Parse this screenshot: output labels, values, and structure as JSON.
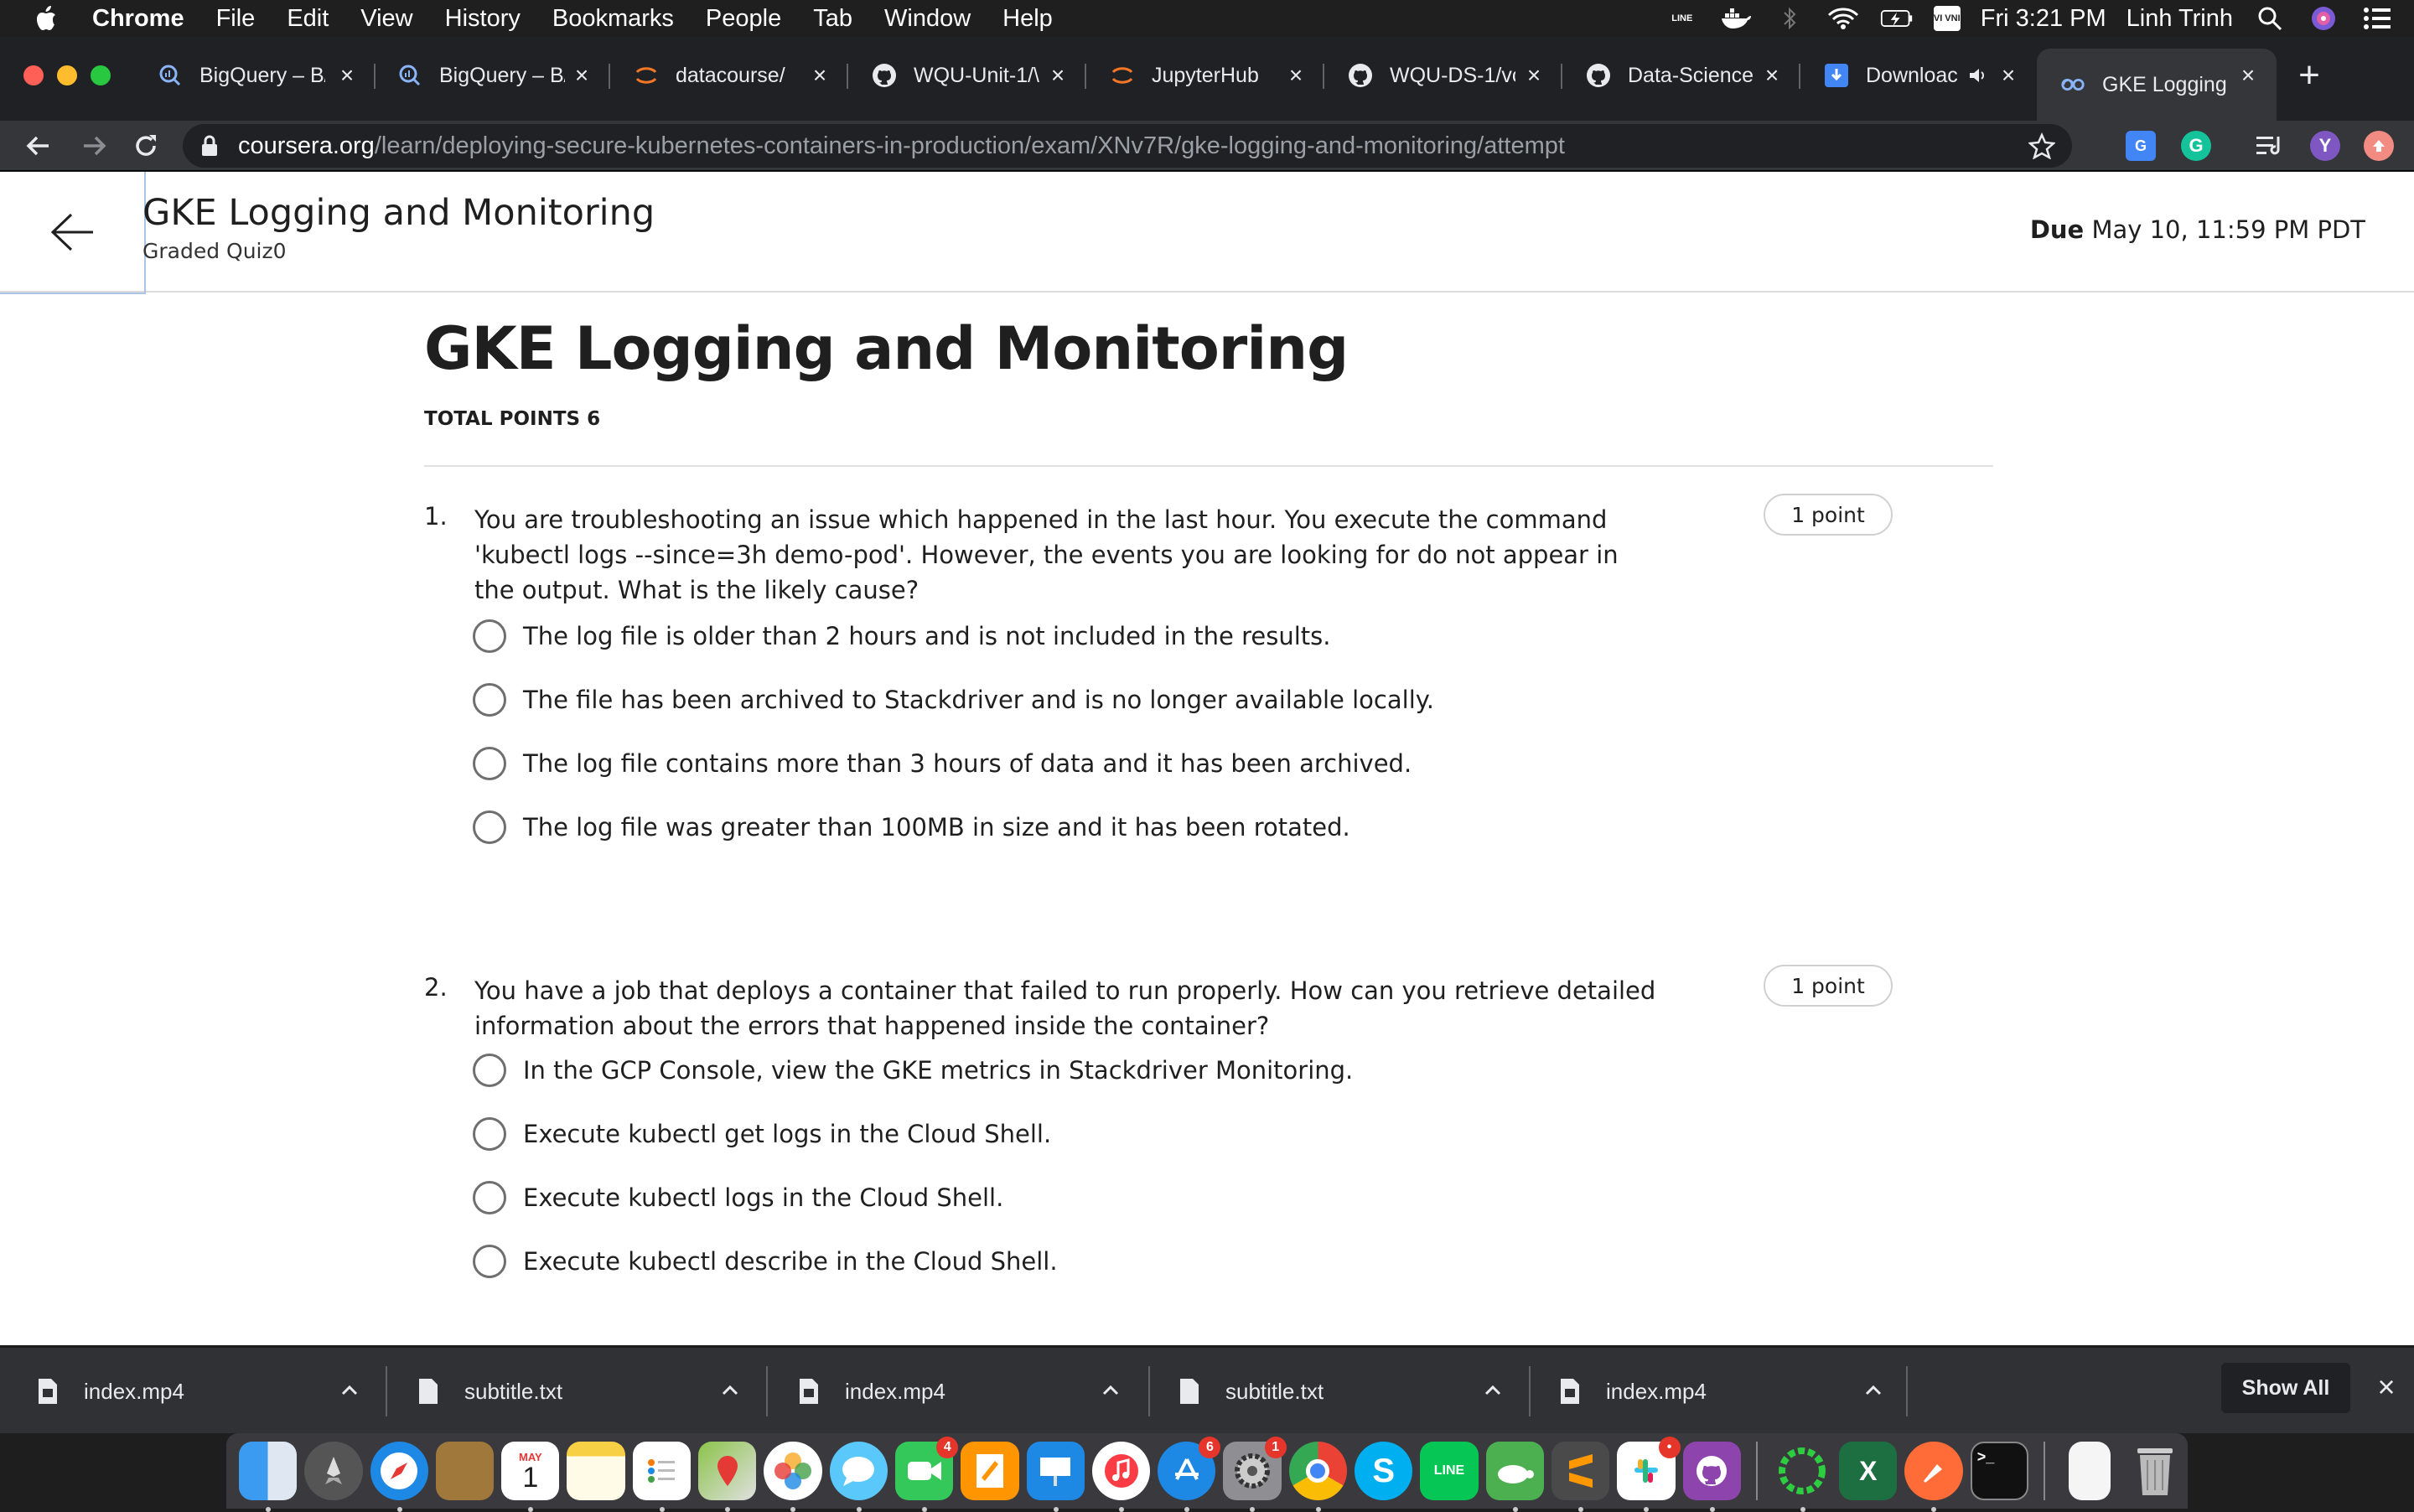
{
  "menubar": {
    "app": "Chrome",
    "items": [
      "File",
      "Edit",
      "View",
      "History",
      "Bookmarks",
      "People",
      "Tab",
      "Window",
      "Help"
    ],
    "status_icons": [
      "line-icon",
      "docker-icon",
      "bluetooth-icon",
      "wifi-icon",
      "battery-icon",
      "input-source-icon"
    ],
    "line_label": "LINE",
    "input_source_label": "VI VNI",
    "clock": "Fri 3:21 PM",
    "user": "Linh Trinh"
  },
  "tabs": [
    {
      "title": "BigQuery – B/",
      "icon": "bigquery-icon"
    },
    {
      "title": "BigQuery – B/",
      "icon": "bigquery-icon"
    },
    {
      "title": "datacourse/",
      "icon": "jupyter-icon"
    },
    {
      "title": "WQU-Unit-1/\\",
      "icon": "github-icon"
    },
    {
      "title": "JupyterHub",
      "icon": "jupyter-icon"
    },
    {
      "title": "WQU-DS-1/vc",
      "icon": "github-icon"
    },
    {
      "title": "Data-Science",
      "icon": "github-icon"
    },
    {
      "title": "Downloac",
      "icon": "download-page-icon"
    },
    {
      "title": "GKE Logging",
      "icon": "coursera-icon"
    }
  ],
  "omnibox": {
    "host": "coursera.org",
    "path": "/learn/deploying-secure-kubernetes-containers-in-production/exam/XNv7R/gke-logging-and-monitoring/attempt"
  },
  "extensions": {
    "grammarly_label": "G",
    "profile_label": "Y"
  },
  "header": {
    "title": "GKE Logging and Monitoring",
    "subtitle": "Graded Quiz0",
    "due_label": "Due",
    "due_value": "May 10, 11:59 PM PDT"
  },
  "quiz": {
    "title": "GKE Logging and Monitoring",
    "total_points": "TOTAL POINTS 6",
    "questions": [
      {
        "number": "1.",
        "text": "You are troubleshooting an issue which happened in the last hour. You execute the command 'kubectl logs --since=3h demo-pod'. However, the events you are looking for do not appear in the output. What is the likely cause?",
        "points": "1 point",
        "options": [
          "The log file is older than 2 hours and is not included in the results.",
          "The file has been archived to Stackdriver and is no longer available locally.",
          "The log file contains more than 3 hours of data and it has been archived.",
          "The log file was greater than 100MB in size and it has been rotated."
        ]
      },
      {
        "number": "2.",
        "text": "You have a job that deploys a container that failed to run properly. How can you retrieve detailed information about the errors that happened inside the container?",
        "points": "1 point",
        "options": [
          "In the GCP Console, view the GKE metrics in Stackdriver Monitoring.",
          "Execute kubectl get logs in the Cloud Shell.",
          "Execute kubectl logs in the Cloud Shell.",
          "Execute kubectl describe in the Cloud Shell."
        ]
      }
    ]
  },
  "downloads": {
    "files": [
      "index.mp4",
      "subtitle.txt",
      "index.mp4",
      "subtitle.txt",
      "index.mp4"
    ],
    "show_all": "Show All"
  },
  "dock": {
    "apps": [
      "finder",
      "launchpad",
      "safari",
      "notes-book",
      "calendar",
      "notes",
      "reminders",
      "maps",
      "photos",
      "messages",
      "facetime",
      "keynote-pages",
      "keynote",
      "music",
      "app-store",
      "system-preferences",
      "chrome",
      "skype",
      "line",
      "turtle",
      "sublime-text",
      "slack",
      "github-desktop",
      "activity",
      "excel",
      "postman",
      "terminal",
      "document",
      "trash"
    ],
    "calendar_month": "MAY",
    "calendar_day": "1",
    "badge_facetime": "4",
    "badge_appstore": "6",
    "badge_sysprefs": "1",
    "badge_slack": "•",
    "skype_label": "S",
    "line_label": "LINE",
    "excel_label": "X",
    "terminal_label": ">_"
  }
}
